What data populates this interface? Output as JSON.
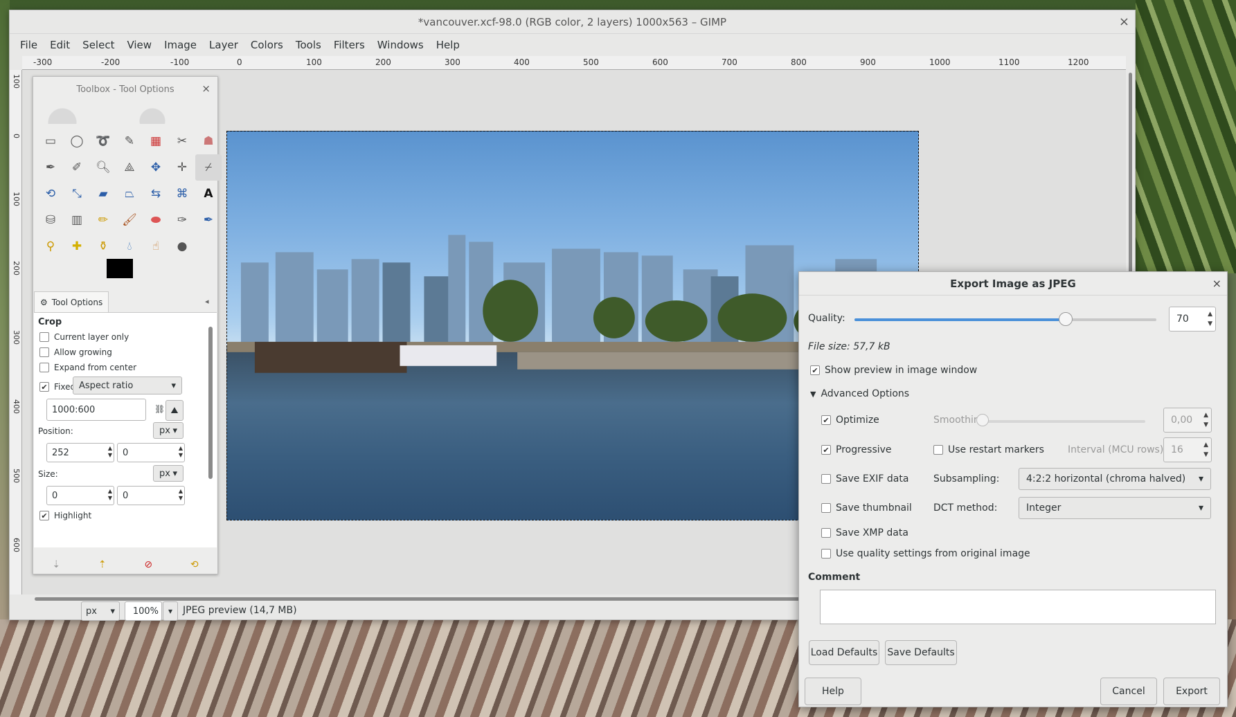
{
  "window": {
    "title": "*vancouver.xcf-98.0 (RGB color, 2 layers) 1000x563 – GIMP",
    "close": "×"
  },
  "menu": [
    "File",
    "Edit",
    "Select",
    "View",
    "Image",
    "Layer",
    "Colors",
    "Tools",
    "Filters",
    "Windows",
    "Help"
  ],
  "ruler": {
    "h_labels": [
      "-300",
      "-200",
      "-100",
      "0",
      "100",
      "200",
      "300",
      "400",
      "500",
      "600",
      "700",
      "800",
      "900",
      "1000",
      "1100",
      "1200"
    ],
    "v_labels": [
      "100",
      "0",
      "100",
      "200",
      "300",
      "400",
      "500",
      "600"
    ]
  },
  "status": {
    "unit": "px",
    "zoom": "100%",
    "message": "JPEG preview (14,7 MB)"
  },
  "toolbox": {
    "title": "Toolbox - Tool Options",
    "close": "×",
    "tools": [
      "rect-select",
      "ellipse-select",
      "free-select",
      "fuzzy-select",
      "select-by-color",
      "scissors",
      "foreground-select",
      "paths",
      "color-picker",
      "zoom",
      "measure",
      "move",
      "align",
      "crop",
      "unified-transform",
      "scale",
      "shear",
      "perspective",
      "flip",
      "cage",
      "text",
      "bucket-fill",
      "gradient",
      "pencil",
      "paintbrush",
      "eraser",
      "airbrush",
      "ink",
      "clone",
      "heal",
      "perspective-clone",
      "blur",
      "smudge",
      "dodge-burn"
    ],
    "tool_options_tab": "Tool Options",
    "options": {
      "section": "Crop",
      "current_layer_only": "Current layer only",
      "allow_growing": "Allow growing",
      "expand_from_center": "Expand from center",
      "fixed_label": "Fixed:",
      "fixed_value": "Aspect ratio",
      "ratio": "1000:600",
      "position_label": "Position:",
      "position_unit": "px",
      "pos_x": "252",
      "pos_y": "0",
      "size_label": "Size:",
      "size_unit": "px",
      "size_w": "0",
      "size_h": "0",
      "highlight": "Highlight"
    }
  },
  "export_dialog": {
    "title": "Export Image as JPEG",
    "close": "×",
    "quality_label": "Quality:",
    "quality_value": "70",
    "quality_fraction": 0.7,
    "file_size": "File size: 57,7 kB",
    "show_preview": "Show preview in image window",
    "advanced": "Advanced Options",
    "optimize": "Optimize",
    "smoothing_label": "Smoothing:",
    "smoothing_value": "0,00",
    "progressive": "Progressive",
    "restart_markers": "Use restart markers",
    "interval_label": "Interval (MCU rows):",
    "interval_value": "16",
    "save_exif": "Save EXIF data",
    "subsampling_label": "Subsampling:",
    "subsampling_value": "4:2:2 horizontal (chroma halved)",
    "save_thumbnail": "Save thumbnail",
    "dct_label": "DCT method:",
    "dct_value": "Integer",
    "save_xmp": "Save XMP data",
    "use_quality": "Use quality settings from original image",
    "comment_label": "Comment",
    "comment_value": "",
    "load_defaults": "Load Defaults",
    "save_defaults": "Save Defaults",
    "help": "Help",
    "cancel": "Cancel",
    "export": "Export"
  },
  "colors": {
    "accent": "#4a90d9",
    "check": "#2e3436"
  }
}
